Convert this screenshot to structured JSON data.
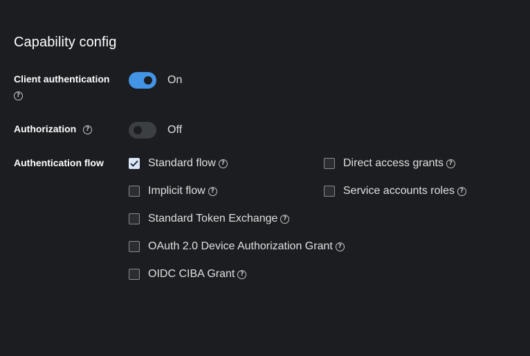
{
  "section": {
    "title": "Capability config"
  },
  "client_authentication": {
    "label": "Client authentication",
    "state_text": "On",
    "enabled": true
  },
  "authorization": {
    "label": "Authorization",
    "state_text": "Off",
    "enabled": false
  },
  "authentication_flow": {
    "label": "Authentication flow",
    "options": [
      {
        "label": "Standard flow",
        "checked": true
      },
      {
        "label": "Direct access grants",
        "checked": false
      },
      {
        "label": "Implicit flow",
        "checked": false
      },
      {
        "label": "Service accounts roles",
        "checked": false
      },
      {
        "label": "Standard Token Exchange",
        "checked": false
      },
      {
        "label": "OAuth 2.0 Device Authorization Grant",
        "checked": false
      },
      {
        "label": "OIDC CIBA Grant",
        "checked": false
      }
    ]
  },
  "icons": {
    "help": "help-circle-icon",
    "check": "checkmark-icon"
  },
  "colors": {
    "background": "#1b1d21",
    "switch_on": "#4394e5",
    "switch_off": "#3c3f42"
  }
}
